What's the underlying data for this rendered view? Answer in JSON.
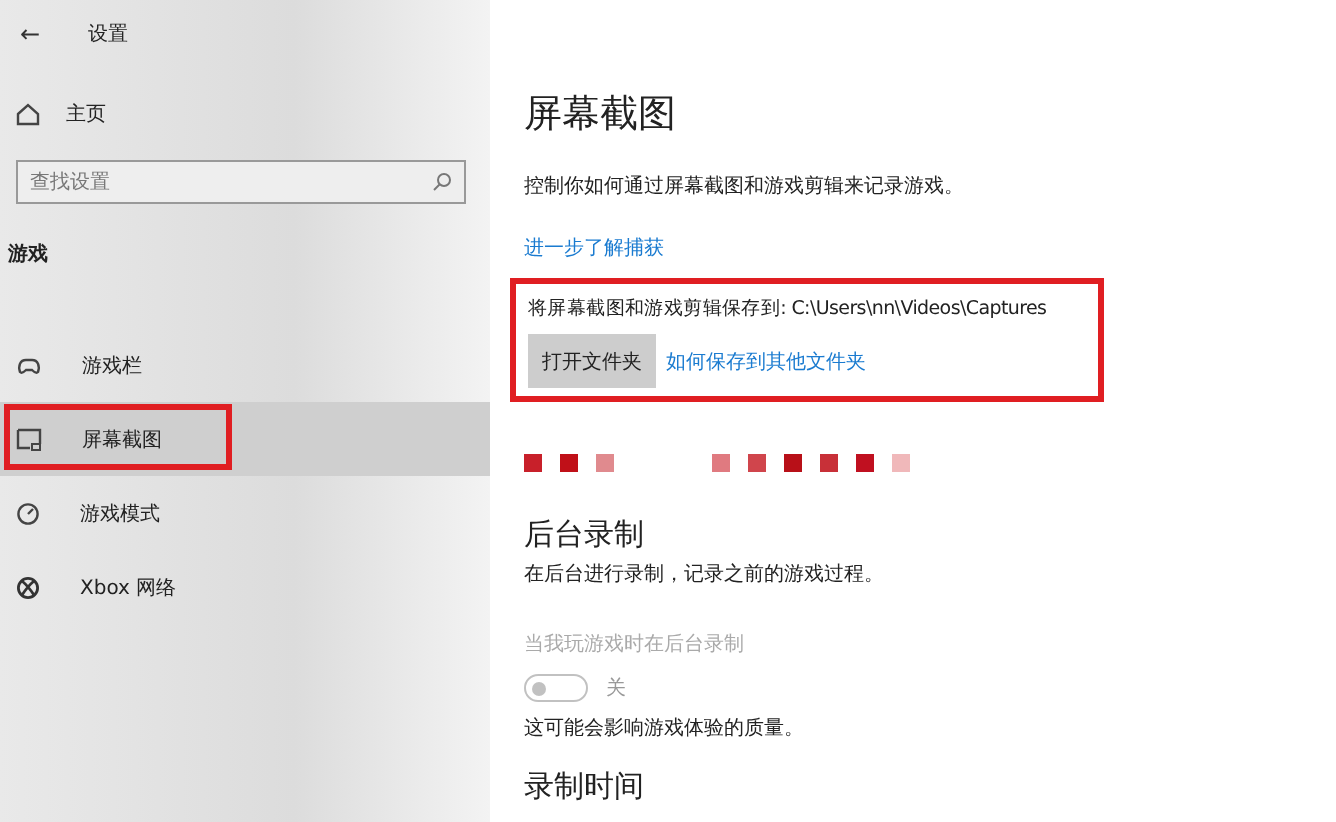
{
  "window": {
    "title": "设置",
    "back": "←"
  },
  "sidebar": {
    "home": {
      "label": "主页"
    },
    "search": {
      "placeholder": "查找设置"
    },
    "section": "游戏",
    "items": [
      {
        "label": "游戏栏",
        "kind": "gamebar",
        "selected": false,
        "highlighted": false
      },
      {
        "label": "屏幕截图",
        "kind": "capture",
        "selected": true,
        "highlighted": true
      },
      {
        "label": "游戏模式",
        "kind": "gamemode",
        "selected": false,
        "highlighted": false
      },
      {
        "label": "Xbox 网络",
        "kind": "xbox",
        "selected": false,
        "highlighted": false
      }
    ]
  },
  "page": {
    "title": "屏幕截图",
    "description": "控制你如何通过屏幕截图和游戏剪辑来记录游戏。",
    "learn_more": "进一步了解捕获",
    "save": {
      "highlighted": true,
      "label": "将屏幕截图和游戏剪辑保存到: C:\\Users\\nn\\Videos\\Captures",
      "button": "打开文件夹",
      "link": "如何保存到其他文件夹"
    },
    "background": {
      "title": "后台录制",
      "description": "在后台进行录制，记录之前的游戏过程。",
      "setting_label": "当我玩游戏时在后台录制",
      "toggle": {
        "on": false,
        "disabled": true,
        "state_label": "关"
      },
      "note": "这可能会影响游戏体验的质量。"
    },
    "next_section": "录制时间"
  }
}
